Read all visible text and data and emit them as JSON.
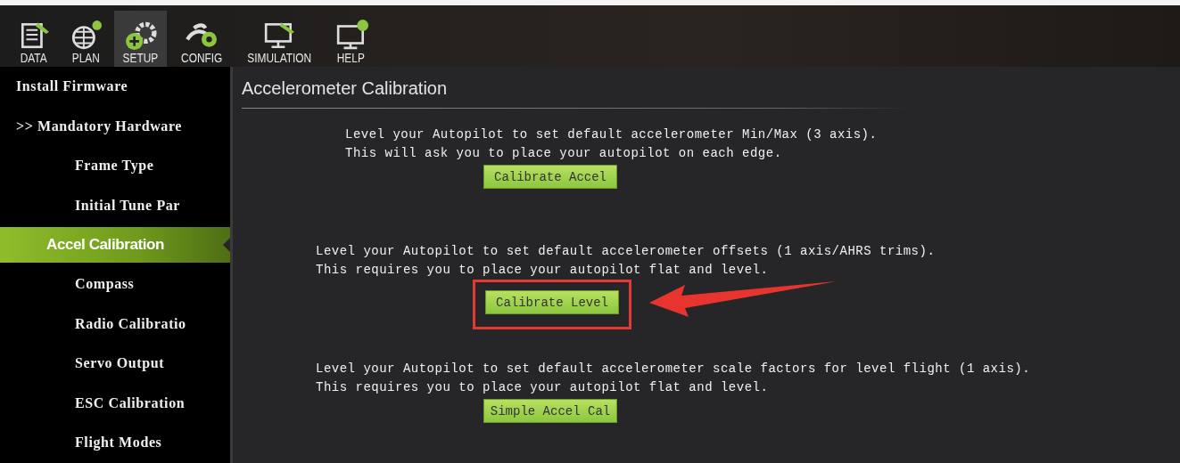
{
  "tabs": [
    {
      "label": "DATA",
      "selected": false,
      "kind": "data"
    },
    {
      "label": "PLAN",
      "selected": false,
      "kind": "plan"
    },
    {
      "label": "SETUP",
      "selected": true,
      "kind": "setup"
    },
    {
      "label": "CONFIG",
      "selected": false,
      "kind": "config"
    },
    {
      "label": "SIMULATION",
      "selected": false,
      "kind": "simulation"
    },
    {
      "label": "HELP",
      "selected": false,
      "kind": "help"
    }
  ],
  "sidebar": {
    "items": [
      {
        "label": "Install Firmware",
        "selected": false
      },
      {
        "label": ">> Mandatory Hardware",
        "selected": false,
        "children": [
          {
            "label": "Frame Type",
            "selected": false
          },
          {
            "label": "Initial Tune Par",
            "selected": false
          },
          {
            "label": "Accel Calibration",
            "selected": true
          },
          {
            "label": "Compass",
            "selected": false
          },
          {
            "label": "Radio Calibratio",
            "selected": false
          },
          {
            "label": "Servo Output",
            "selected": false
          },
          {
            "label": "ESC Calibration",
            "selected": false
          },
          {
            "label": "Flight Modes",
            "selected": false
          }
        ]
      }
    ]
  },
  "panel": {
    "title": "Accelerometer Calibration",
    "sections": [
      {
        "lines": [
          "Level your Autopilot to set default accelerometer Min/Max (3 axis).",
          "This will ask you to place your autopilot on each edge."
        ],
        "button": "Calibrate Accel",
        "highlighted": false
      },
      {
        "lines": [
          "Level your Autopilot to set default accelerometer offsets (1 axis/AHRS trims).",
          "This requires you to place your autopilot flat and level."
        ],
        "button": "Calibrate Level",
        "highlighted": true
      },
      {
        "lines": [
          "Level your Autopilot to set default accelerometer scale factors for level flight (1 axis).",
          "This requires you to place your autopilot flat and level."
        ],
        "button": "Simple Accel Cal",
        "highlighted": false
      }
    ]
  }
}
